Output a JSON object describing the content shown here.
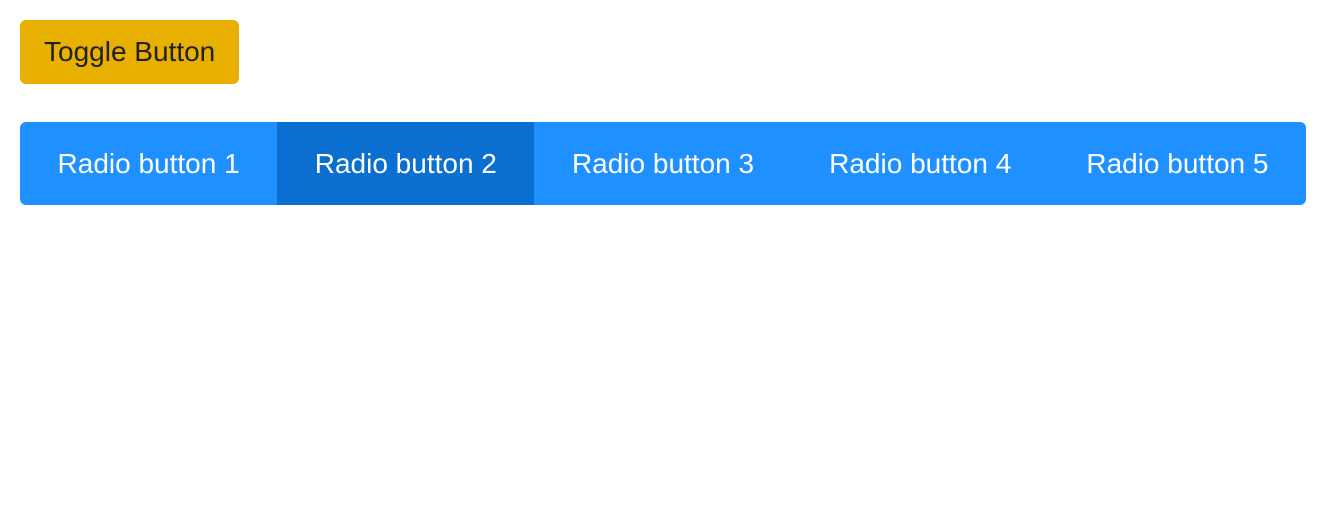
{
  "toggle": {
    "label": "Toggle Button"
  },
  "radio": {
    "active_index": 1,
    "items": [
      {
        "label": "Radio button 1"
      },
      {
        "label": "Radio button 2"
      },
      {
        "label": "Radio button 3"
      },
      {
        "label": "Radio button 4"
      },
      {
        "label": "Radio button 5"
      }
    ]
  },
  "colors": {
    "toggle_bg": "#e8b000",
    "radio_bg": "#1e90ff",
    "radio_active_bg": "#0b6ed1"
  }
}
